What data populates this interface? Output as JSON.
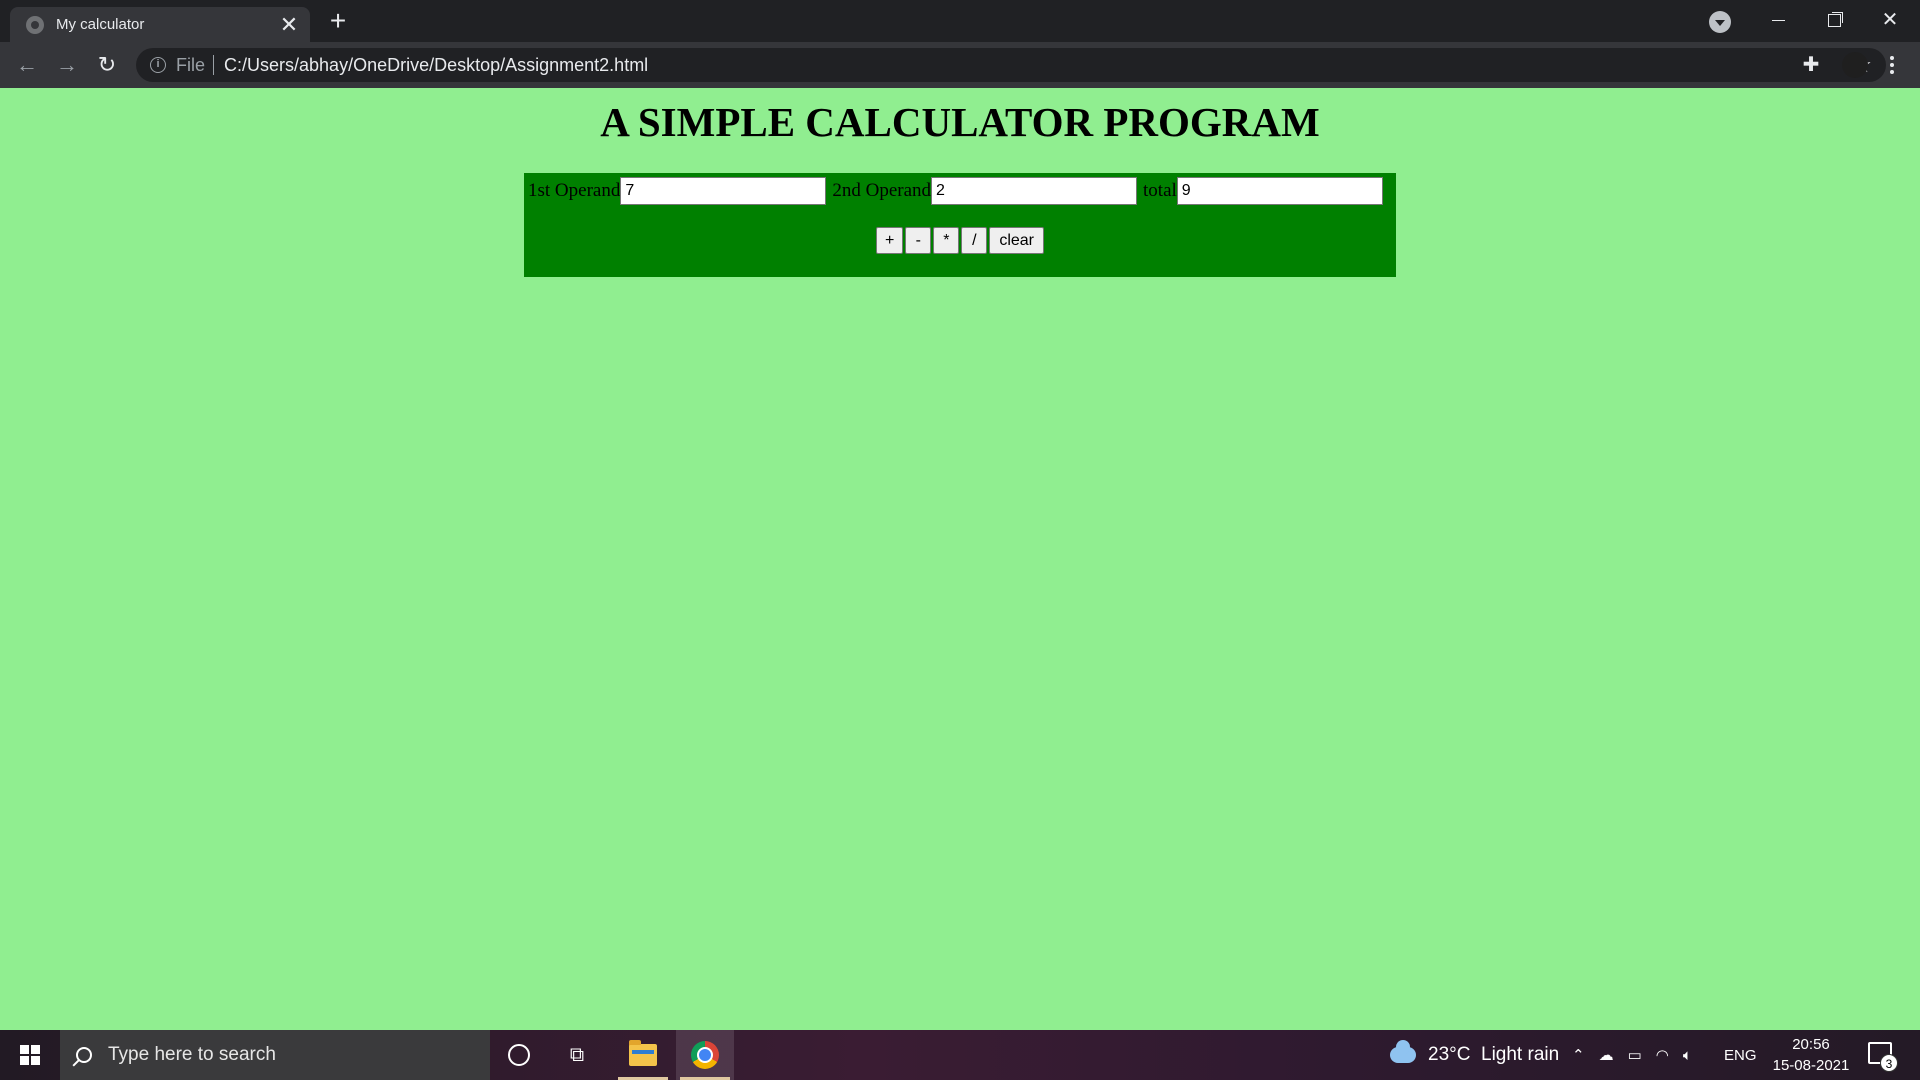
{
  "browser": {
    "tab_title": "My calculator",
    "tab_close": "✕",
    "new_tab": "+",
    "scheme": "File",
    "url": "C:/Users/abhay/OneDrive/Desktop/Assignment2.html"
  },
  "page": {
    "title": "A SIMPLE CALCULATOR PROGRAM",
    "operand1_label": "1st Operand",
    "operand1_value": "7",
    "operand2_label": "2nd Operand",
    "operand2_value": "2",
    "total_label": "total",
    "total_value": "9",
    "buttons": {
      "add": "+",
      "subtract": "-",
      "multiply": "*",
      "divide": "/",
      "clear": "clear"
    },
    "colors": {
      "background": "#90ee90",
      "panel": "#008000"
    }
  },
  "taskbar": {
    "search_placeholder": "Type here to search",
    "weather": "23°C  Light rain",
    "language": "ENG",
    "time": "20:56",
    "date": "15-08-2021",
    "notification_count": "3"
  },
  "icons": {
    "back": "arrow-left-icon",
    "forward": "arrow-right-icon",
    "reload": "reload-icon",
    "info": "info-icon",
    "star": "star-icon",
    "extensions": "puzzle-icon",
    "menu": "kebab-menu-icon"
  }
}
